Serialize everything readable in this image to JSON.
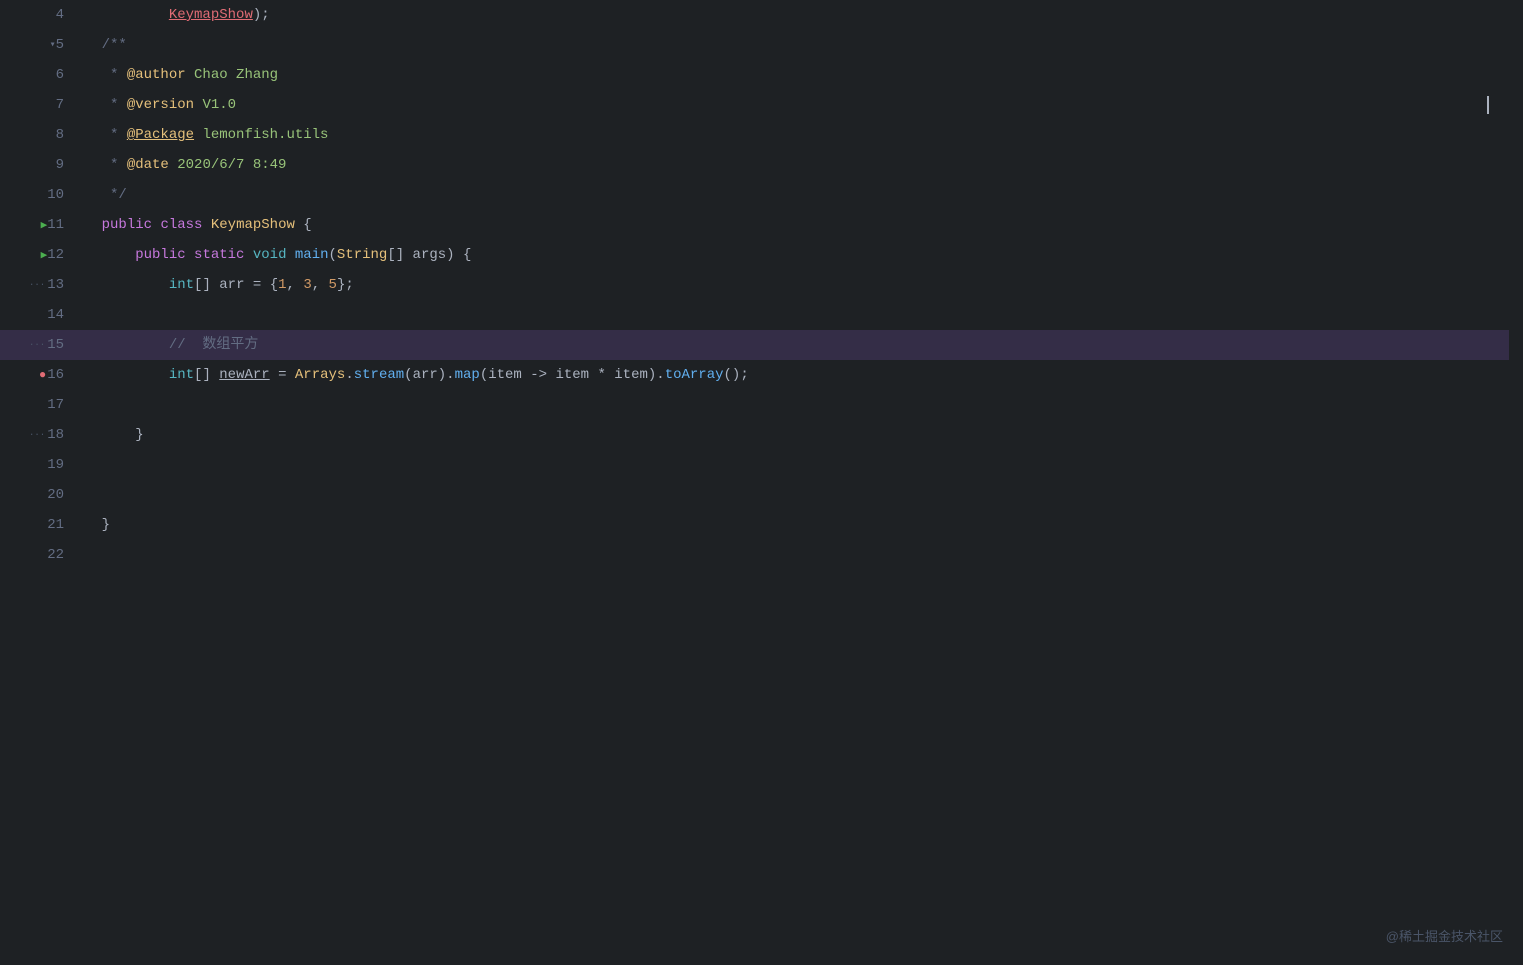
{
  "editor": {
    "background": "#1e2124",
    "lines": [
      {
        "num": 4,
        "content": "",
        "tokens": [],
        "gutter": {
          "icon": null
        }
      },
      {
        "num": 5,
        "content": "    /**",
        "gutter": {
          "icon": "fold"
        }
      },
      {
        "num": 6,
        "content": "     * @author Chao Zhang",
        "gutter": {
          "icon": null
        }
      },
      {
        "num": 7,
        "content": "     * @version V1.0",
        "gutter": {
          "icon": null
        }
      },
      {
        "num": 8,
        "content": "     * @Package lemonfish.utils",
        "gutter": {
          "icon": null
        }
      },
      {
        "num": 9,
        "content": "     * @date 2020/6/7 8:49",
        "gutter": {
          "icon": null
        }
      },
      {
        "num": 10,
        "content": "     */",
        "gutter": {
          "icon": null
        }
      },
      {
        "num": 11,
        "content": "    public class KeymapShow {",
        "gutter": {
          "icon": "run"
        }
      },
      {
        "num": 12,
        "content": "        public static void main(String[] args) {",
        "gutter": {
          "icon": "run"
        }
      },
      {
        "num": 13,
        "content": "            int[] arr = {1, 3, 5};",
        "gutter": {
          "icon": null
        }
      },
      {
        "num": 14,
        "content": "",
        "gutter": {
          "icon": null
        }
      },
      {
        "num": 15,
        "content": "            //  数组平方",
        "gutter": {
          "icon": null
        },
        "highlight": true
      },
      {
        "num": 16,
        "content": "            int[] newArr = Arrays.stream(arr).map(item -> item * item).toArray();",
        "gutter": {
          "icon": "breakpoint"
        }
      },
      {
        "num": 17,
        "content": "",
        "gutter": {
          "icon": null
        }
      },
      {
        "num": 18,
        "content": "        }",
        "gutter": {
          "icon": null
        }
      },
      {
        "num": 19,
        "content": "",
        "gutter": {
          "icon": null
        }
      },
      {
        "num": 20,
        "content": "",
        "gutter": {
          "icon": null
        }
      },
      {
        "num": 21,
        "content": "    }",
        "gutter": {
          "icon": null
        }
      },
      {
        "num": 22,
        "content": "",
        "gutter": {
          "icon": null
        }
      }
    ],
    "watermark": "@稀土掘金技术社区",
    "cursor_line": 7,
    "active_line": 15
  }
}
